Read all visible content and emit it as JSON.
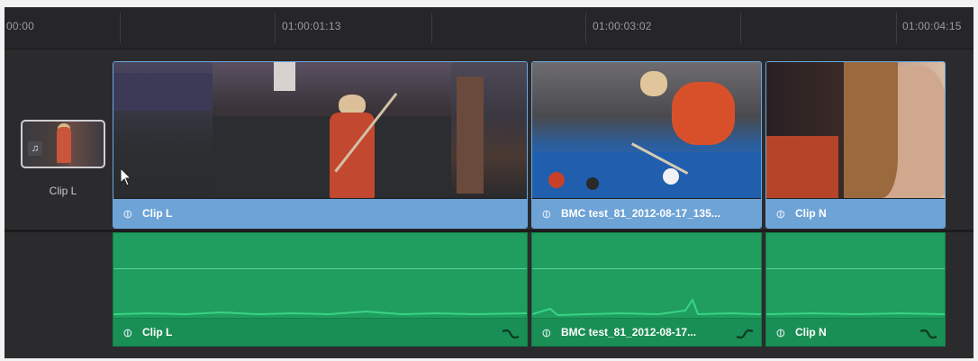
{
  "ruler": {
    "timecodes": [
      "00:00",
      "01:00:01:13",
      "01:00:03:02",
      "01:00:04:15"
    ]
  },
  "source_thumb": {
    "label": "Clip L",
    "icon": "music-note-icon"
  },
  "video_clips": [
    {
      "name": "Clip L"
    },
    {
      "name": "BMC test_81_2012-08-17_135..."
    },
    {
      "name": "Clip N"
    }
  ],
  "audio_clips": [
    {
      "name": "Clip L"
    },
    {
      "name": "BMC test_81_2012-08-17..."
    },
    {
      "name": "Clip N"
    }
  ],
  "colors": {
    "video_bar": "#6ea3d6",
    "audio_fill": "#1f9e5f",
    "selection_border": "#6aa8de"
  }
}
